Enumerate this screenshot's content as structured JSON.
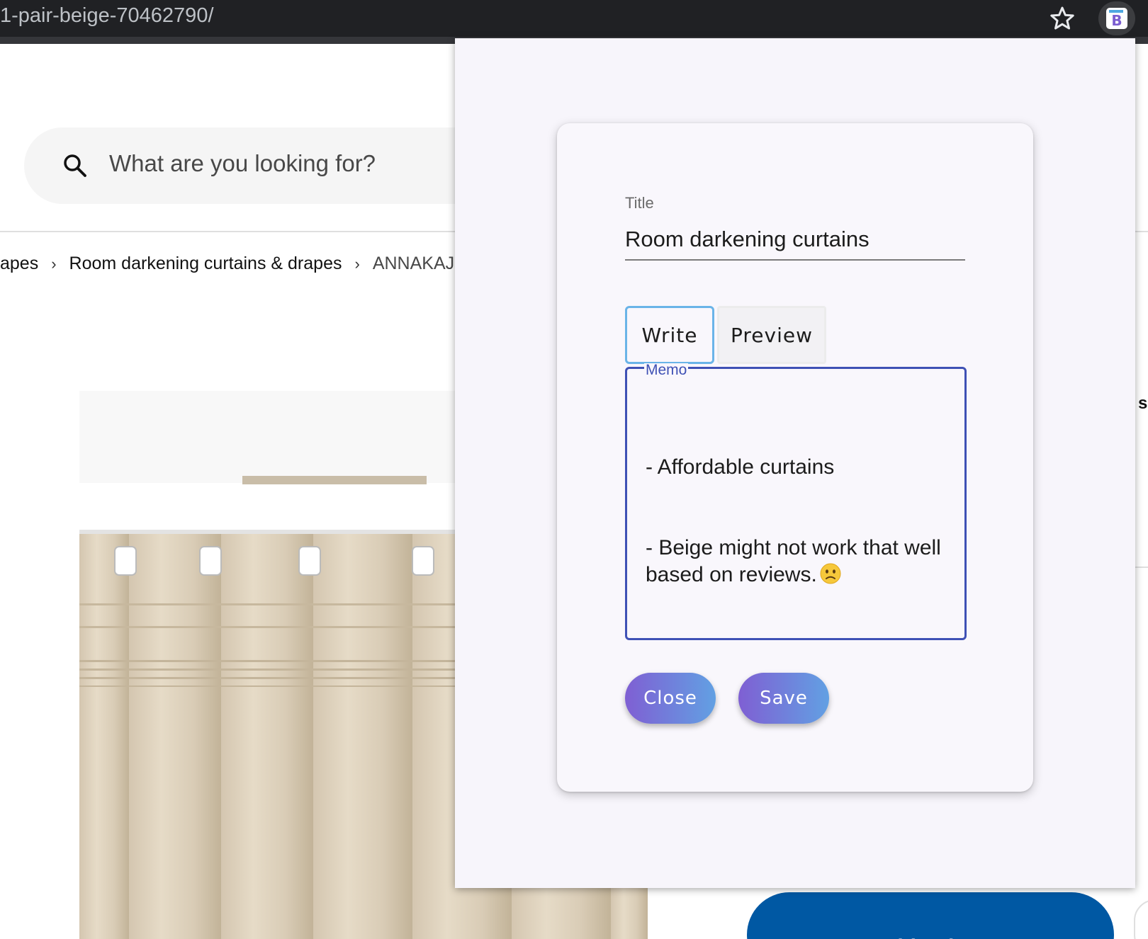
{
  "browser": {
    "url_fragment": "1-pair-beige-70462790/",
    "bookmark_icon": "star-icon",
    "extension_icon": "extension-b-icon",
    "extension_letter": "B"
  },
  "site": {
    "search_placeholder": "What are you looking for?",
    "breadcrumb": [
      "apes",
      "Room darkening curtains & drapes",
      "ANNAKAJS"
    ],
    "add_to_bag_label": "Add to bag",
    "right_edge_char": "s",
    "accent_color": "#0058a3"
  },
  "popup": {
    "title_label": "Title",
    "title_value": "Room darkening curtains",
    "tabs": [
      {
        "label": "Write",
        "active": true
      },
      {
        "label": "Preview",
        "active": false
      }
    ],
    "memo_label": "Memo",
    "memo_lines": [
      "- Affordable curtains",
      "- Beige might not work that well based on reviews."
    ],
    "memo_emoji": "slightly-frowning-face-icon",
    "close_label": "Close",
    "save_label": "Save",
    "focus_color": "#3f51b5",
    "button_gradient": [
      "#7f5fd3",
      "#62a0e3"
    ]
  }
}
